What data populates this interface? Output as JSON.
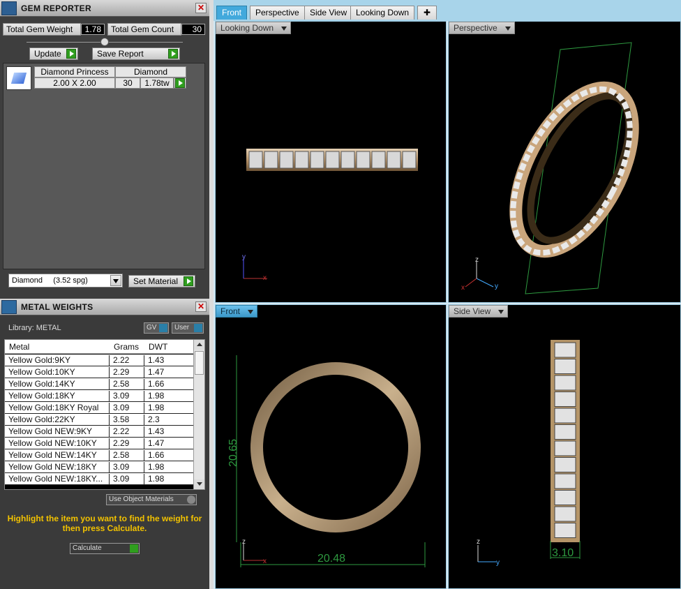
{
  "gem_reporter": {
    "title": "GEM REPORTER",
    "total_weight_label": "Total Gem Weight",
    "total_weight_value": "1.78",
    "total_count_label": "Total Gem Count",
    "total_count_value": "30",
    "update_label": "Update",
    "save_label": "Save Report",
    "gem_row": {
      "name": "Diamond Princess",
      "material": "Diamond",
      "size": "2.00 X 2.00",
      "count": "30",
      "weight": "1.78tw"
    },
    "material_select": "Diamond     (3.52 spg)",
    "set_material_label": "Set Material"
  },
  "metal_weights": {
    "title": "METAL WEIGHTS",
    "library": "Library: METAL",
    "gv_label": "GV",
    "user_label": "User",
    "columns": [
      "Metal",
      "Grams",
      "DWT"
    ],
    "rows": [
      {
        "metal": "Yellow Gold:9KY",
        "grams": "2.22",
        "dwt": "1.43"
      },
      {
        "metal": "Yellow Gold:10KY",
        "grams": "2.29",
        "dwt": "1.47"
      },
      {
        "metal": "Yellow Gold:14KY",
        "grams": "2.58",
        "dwt": "1.66"
      },
      {
        "metal": "Yellow Gold:18KY",
        "grams": "3.09",
        "dwt": "1.98"
      },
      {
        "metal": "Yellow Gold:18KY Royal",
        "grams": "3.09",
        "dwt": "1.98"
      },
      {
        "metal": "Yellow Gold:22KY",
        "grams": "3.58",
        "dwt": "2.3"
      },
      {
        "metal": "Yellow Gold NEW:9KY",
        "grams": "2.22",
        "dwt": "1.43"
      },
      {
        "metal": "Yellow Gold NEW:10KY",
        "grams": "2.29",
        "dwt": "1.47"
      },
      {
        "metal": "Yellow Gold NEW:14KY",
        "grams": "2.58",
        "dwt": "1.66"
      },
      {
        "metal": "Yellow Gold NEW:18KY",
        "grams": "3.09",
        "dwt": "1.98"
      },
      {
        "metal": "Yellow Gold NEW:18KY...",
        "grams": "3.09",
        "dwt": "1.98"
      }
    ],
    "use_object_materials": "Use Object Materials",
    "hint": "Highlight the item you want to find the weight for then press Calculate.",
    "calculate_label": "Calculate"
  },
  "viewport": {
    "tabs": [
      "Front",
      "Perspective",
      "Side View",
      "Looking Down"
    ],
    "active_tab": "Front",
    "views": {
      "top_left": "Looking Down",
      "top_right": "Perspective",
      "bottom_left": "Front",
      "bottom_right": "Side View"
    },
    "dimensions": {
      "front_height": "20.65",
      "front_width": "20.48",
      "side_width": "3.10"
    },
    "axes": {
      "x": "x",
      "y": "y",
      "z": "z"
    }
  },
  "colors": {
    "accent": "#42a9dc",
    "gold": "#c9a57c",
    "green": "#2f9e1e",
    "hint": "#f2c200"
  }
}
